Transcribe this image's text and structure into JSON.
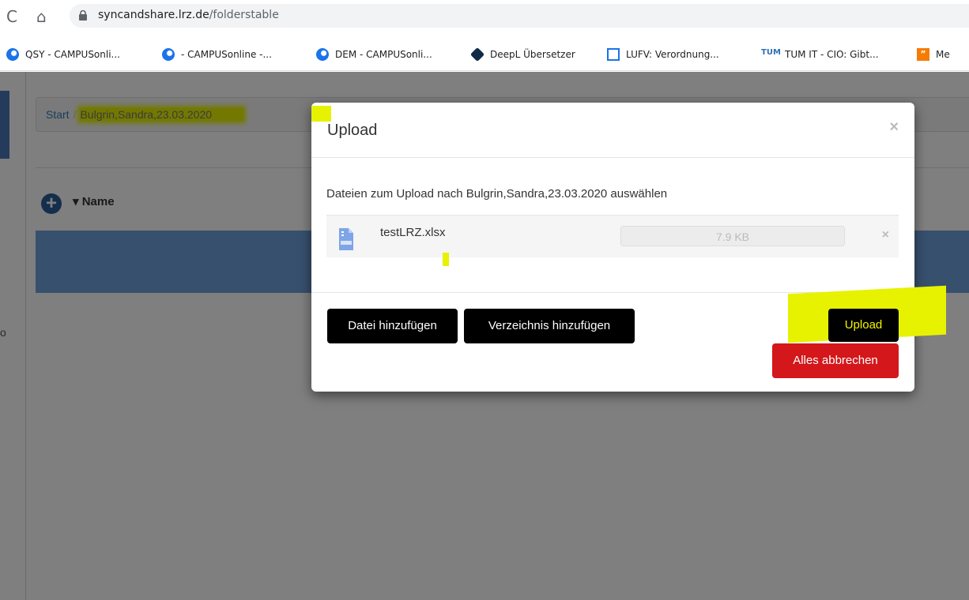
{
  "browser": {
    "url_host": "syncandshare.lrz.de",
    "url_path": "/folderstable",
    "bookmarks": [
      {
        "label": "QSY - CAMPUSonli...",
        "icon": "campusonline-icon"
      },
      {
        "label": "- CAMPUSonline -...",
        "icon": "campusonline-icon"
      },
      {
        "label": "DEM - CAMPUSonli...",
        "icon": "campusonline-icon"
      },
      {
        "label": "DeepL Übersetzer",
        "icon": "deepl-icon"
      },
      {
        "label": "LUFV: Verordnung...",
        "icon": "document-icon"
      },
      {
        "label": "TUM IT - CIO: Gibt...",
        "icon": "tum-icon"
      },
      {
        "label": "Me",
        "icon": "bookmark-icon"
      }
    ]
  },
  "page": {
    "breadcrumb": {
      "start": "Start",
      "separator": "/",
      "current": "Bulgrin,Sandra,23.03.2020"
    },
    "name_column": "Name",
    "plus_symbol": "+",
    "side_char": "o"
  },
  "modal": {
    "title": "Upload",
    "close": "×",
    "intro": "Dateien zum Upload nach Bulgrin,Sandra,23.03.2020 auswählen",
    "file": {
      "name": "testLRZ.xlsx",
      "size": "7.9 KB",
      "progress": 0.0,
      "remove": "×"
    },
    "buttons": {
      "add_file": "Datei hinzufügen",
      "add_dir": "Verzeichnis hinzufügen",
      "upload": "Upload",
      "cancel_all": "Alles abbrechen"
    }
  },
  "colors": {
    "highlight": "#e6f200",
    "cancel": "#d3171b",
    "selected_row": "#6fa0dd",
    "plus_button": "#2c5d9a"
  }
}
